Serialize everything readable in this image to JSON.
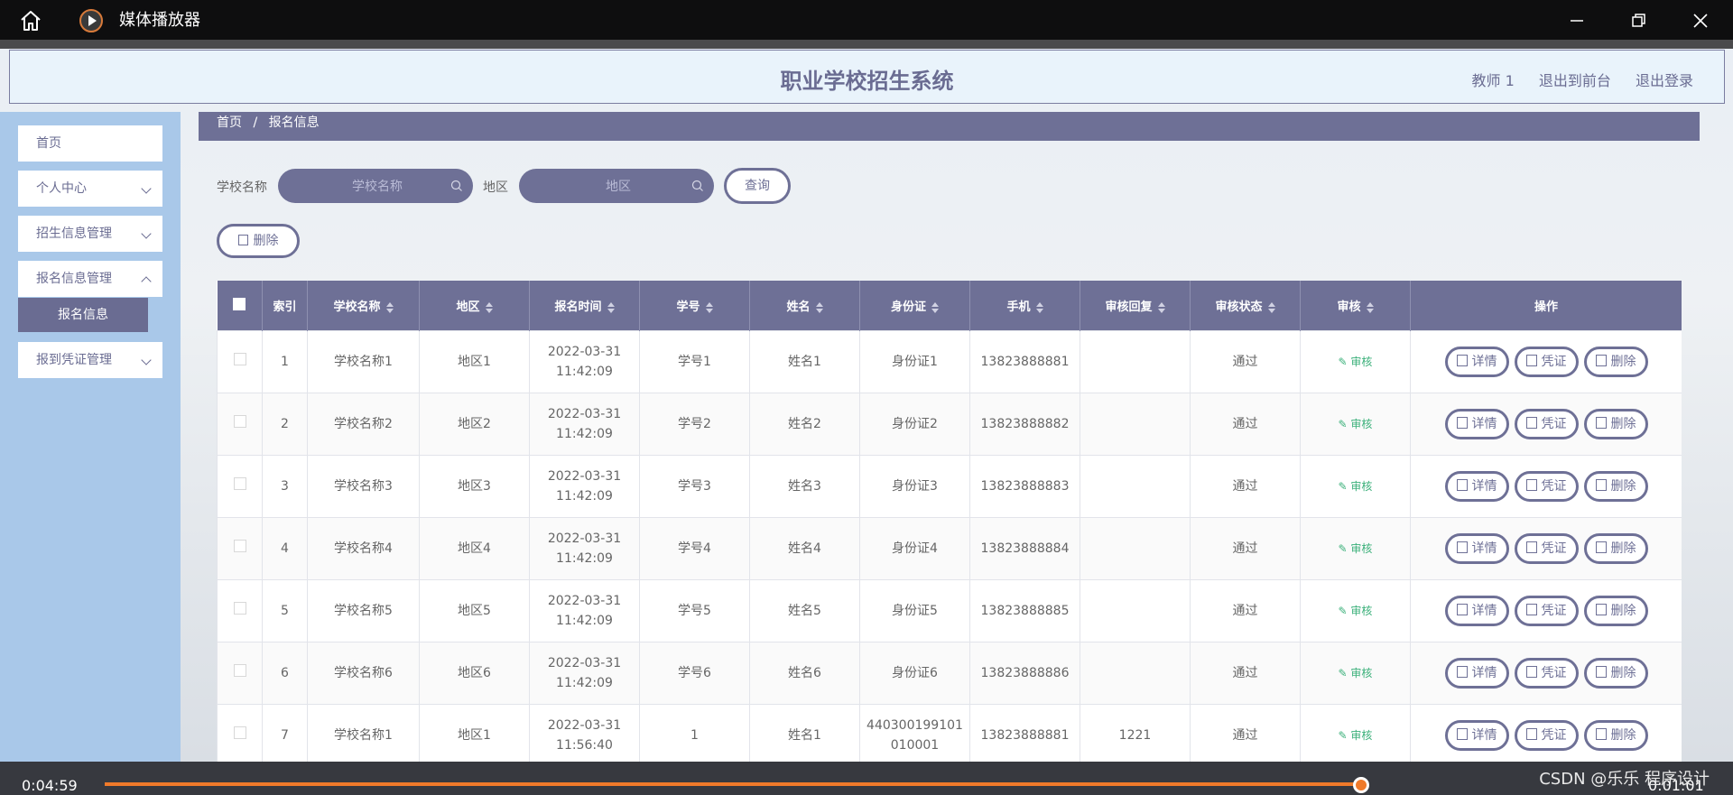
{
  "window": {
    "title": "媒体播放器",
    "icons": [
      "home-icon",
      "media-player-icon",
      "minimize-icon",
      "restore-icon",
      "close-icon"
    ]
  },
  "header": {
    "system_title": "职业学校招生系统",
    "user": "教师 1",
    "to_front": "退出到前台",
    "logout": "退出登录"
  },
  "sidebar": {
    "items": [
      {
        "label": "首页"
      },
      {
        "label": "个人中心"
      },
      {
        "label": "招生信息管理"
      },
      {
        "label": "报名信息管理"
      },
      {
        "label": "报到凭证管理"
      }
    ],
    "active_sub": "报名信息"
  },
  "breadcrumb": {
    "home": "首页",
    "sep": "/",
    "current": "报名信息"
  },
  "search": {
    "school_label": "学校名称",
    "school_placeholder": "学校名称",
    "region_label": "地区",
    "region_placeholder": "地区",
    "query_button": "查询",
    "delete_button": "删除"
  },
  "table": {
    "headers": [
      "索引",
      "学校名称",
      "地区",
      "报名时间",
      "学号",
      "姓名",
      "身份证",
      "手机",
      "审核回复",
      "审核状态",
      "审核",
      "操作"
    ],
    "audit_label": "审核",
    "actions": {
      "detail": "详情",
      "voucher": "凭证",
      "delete": "删除"
    },
    "rows": [
      {
        "index": "1",
        "school": "学校名称1",
        "region": "地区1",
        "time": "2022-03-31 11:42:09",
        "student_no": "学号1",
        "name": "姓名1",
        "id_card": "身份证1",
        "phone": "13823888881",
        "reply": "",
        "status": "通过"
      },
      {
        "index": "2",
        "school": "学校名称2",
        "region": "地区2",
        "time": "2022-03-31 11:42:09",
        "student_no": "学号2",
        "name": "姓名2",
        "id_card": "身份证2",
        "phone": "13823888882",
        "reply": "",
        "status": "通过"
      },
      {
        "index": "3",
        "school": "学校名称3",
        "region": "地区3",
        "time": "2022-03-31 11:42:09",
        "student_no": "学号3",
        "name": "姓名3",
        "id_card": "身份证3",
        "phone": "13823888883",
        "reply": "",
        "status": "通过"
      },
      {
        "index": "4",
        "school": "学校名称4",
        "region": "地区4",
        "time": "2022-03-31 11:42:09",
        "student_no": "学号4",
        "name": "姓名4",
        "id_card": "身份证4",
        "phone": "13823888884",
        "reply": "",
        "status": "通过"
      },
      {
        "index": "5",
        "school": "学校名称5",
        "region": "地区5",
        "time": "2022-03-31 11:42:09",
        "student_no": "学号5",
        "name": "姓名5",
        "id_card": "身份证5",
        "phone": "13823888885",
        "reply": "",
        "status": "通过"
      },
      {
        "index": "6",
        "school": "学校名称6",
        "region": "地区6",
        "time": "2022-03-31 11:42:09",
        "student_no": "学号6",
        "name": "姓名6",
        "id_card": "身份证6",
        "phone": "13823888886",
        "reply": "",
        "status": "通过"
      },
      {
        "index": "7",
        "school": "学校名称1",
        "region": "地区1",
        "time": "2022-03-31 11:56:40",
        "student_no": "1",
        "name": "姓名1",
        "id_card": "440300199101010001",
        "phone": "13823888881",
        "reply": "1221",
        "status": "通过"
      }
    ]
  },
  "player": {
    "elapsed": "0:04:59",
    "remaining": "0:01:01",
    "progress": 0.83,
    "watermark": "CSDN @乐乐 程序设计"
  }
}
